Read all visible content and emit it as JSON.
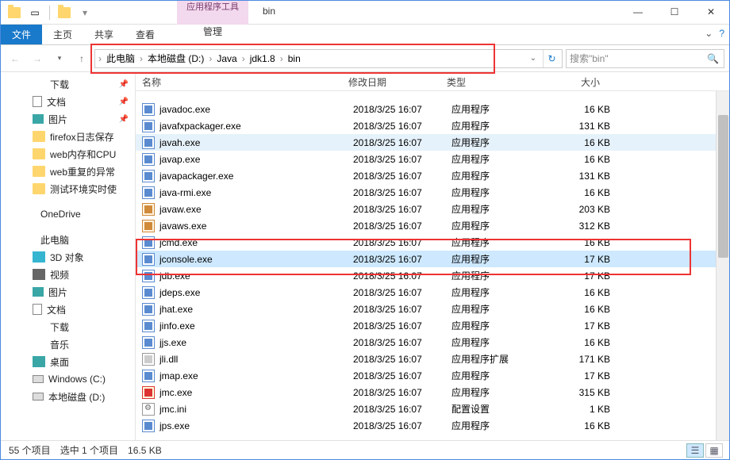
{
  "title": "bin",
  "context_tab": {
    "header": "应用程序工具",
    "tab": "管理"
  },
  "ribbon": [
    "文件",
    "主页",
    "共享",
    "查看"
  ],
  "breadcrumb": [
    "此电脑",
    "本地磁盘 (D:)",
    "Java",
    "jdk1.8",
    "bin"
  ],
  "search_placeholder": "搜索\"bin\"",
  "headers": {
    "name": "名称",
    "date": "修改日期",
    "type": "类型",
    "size": "大小"
  },
  "tree": {
    "quick": [
      {
        "label": "下载",
        "icon": "dl",
        "pin": true
      },
      {
        "label": "文档",
        "icon": "doc",
        "pin": true
      },
      {
        "label": "图片",
        "icon": "pic",
        "pin": true
      },
      {
        "label": "firefox日志保存",
        "icon": "folder"
      },
      {
        "label": "web内存和CPU",
        "icon": "folder"
      },
      {
        "label": "web重复的异常",
        "icon": "folder"
      },
      {
        "label": "测试环境实时使",
        "icon": "folder"
      }
    ],
    "onedrive": "OneDrive",
    "thispc": "此电脑",
    "pc_children": [
      {
        "label": "3D 对象",
        "icon": "3d"
      },
      {
        "label": "视频",
        "icon": "video"
      },
      {
        "label": "图片",
        "icon": "pic"
      },
      {
        "label": "文档",
        "icon": "doc"
      },
      {
        "label": "下载",
        "icon": "dl"
      },
      {
        "label": "音乐",
        "icon": "music"
      },
      {
        "label": "桌面",
        "icon": "desk"
      },
      {
        "label": "Windows (C:)",
        "icon": "drive"
      },
      {
        "label": "本地磁盘 (D:)",
        "icon": "drive"
      }
    ]
  },
  "files": [
    {
      "name": "javadoc.exe",
      "date": "2018/3/25 16:07",
      "type": "应用程序",
      "size": "16 KB",
      "ico": "exe"
    },
    {
      "name": "javafxpackager.exe",
      "date": "2018/3/25 16:07",
      "type": "应用程序",
      "size": "131 KB",
      "ico": "exe"
    },
    {
      "name": "javah.exe",
      "date": "2018/3/25 16:07",
      "type": "应用程序",
      "size": "16 KB",
      "ico": "exe",
      "hover": true
    },
    {
      "name": "javap.exe",
      "date": "2018/3/25 16:07",
      "type": "应用程序",
      "size": "16 KB",
      "ico": "exe"
    },
    {
      "name": "javapackager.exe",
      "date": "2018/3/25 16:07",
      "type": "应用程序",
      "size": "131 KB",
      "ico": "exe"
    },
    {
      "name": "java-rmi.exe",
      "date": "2018/3/25 16:07",
      "type": "应用程序",
      "size": "16 KB",
      "ico": "exe"
    },
    {
      "name": "javaw.exe",
      "date": "2018/3/25 16:07",
      "type": "应用程序",
      "size": "203 KB",
      "ico": "java"
    },
    {
      "name": "javaws.exe",
      "date": "2018/3/25 16:07",
      "type": "应用程序",
      "size": "312 KB",
      "ico": "java"
    },
    {
      "name": "jcmd.exe",
      "date": "2018/3/25 16:07",
      "type": "应用程序",
      "size": "16 KB",
      "ico": "exe"
    },
    {
      "name": "jconsole.exe",
      "date": "2018/3/25 16:07",
      "type": "应用程序",
      "size": "17 KB",
      "ico": "exe",
      "sel": true
    },
    {
      "name": "jdb.exe",
      "date": "2018/3/25 16:07",
      "type": "应用程序",
      "size": "17 KB",
      "ico": "exe"
    },
    {
      "name": "jdeps.exe",
      "date": "2018/3/25 16:07",
      "type": "应用程序",
      "size": "16 KB",
      "ico": "exe"
    },
    {
      "name": "jhat.exe",
      "date": "2018/3/25 16:07",
      "type": "应用程序",
      "size": "16 KB",
      "ico": "exe"
    },
    {
      "name": "jinfo.exe",
      "date": "2018/3/25 16:07",
      "type": "应用程序",
      "size": "17 KB",
      "ico": "exe"
    },
    {
      "name": "jjs.exe",
      "date": "2018/3/25 16:07",
      "type": "应用程序",
      "size": "16 KB",
      "ico": "exe"
    },
    {
      "name": "jli.dll",
      "date": "2018/3/25 16:07",
      "type": "应用程序扩展",
      "size": "171 KB",
      "ico": "dll"
    },
    {
      "name": "jmap.exe",
      "date": "2018/3/25 16:07",
      "type": "应用程序",
      "size": "17 KB",
      "ico": "exe"
    },
    {
      "name": "jmc.exe",
      "date": "2018/3/25 16:07",
      "type": "应用程序",
      "size": "315 KB",
      "ico": "jmc"
    },
    {
      "name": "jmc.ini",
      "date": "2018/3/25 16:07",
      "type": "配置设置",
      "size": "1 KB",
      "ico": "ini"
    },
    {
      "name": "jps.exe",
      "date": "2018/3/25 16:07",
      "type": "应用程序",
      "size": "16 KB",
      "ico": "exe"
    }
  ],
  "status": {
    "count": "55 个项目",
    "selected": "选中 1 个项目",
    "size": "16.5 KB"
  }
}
